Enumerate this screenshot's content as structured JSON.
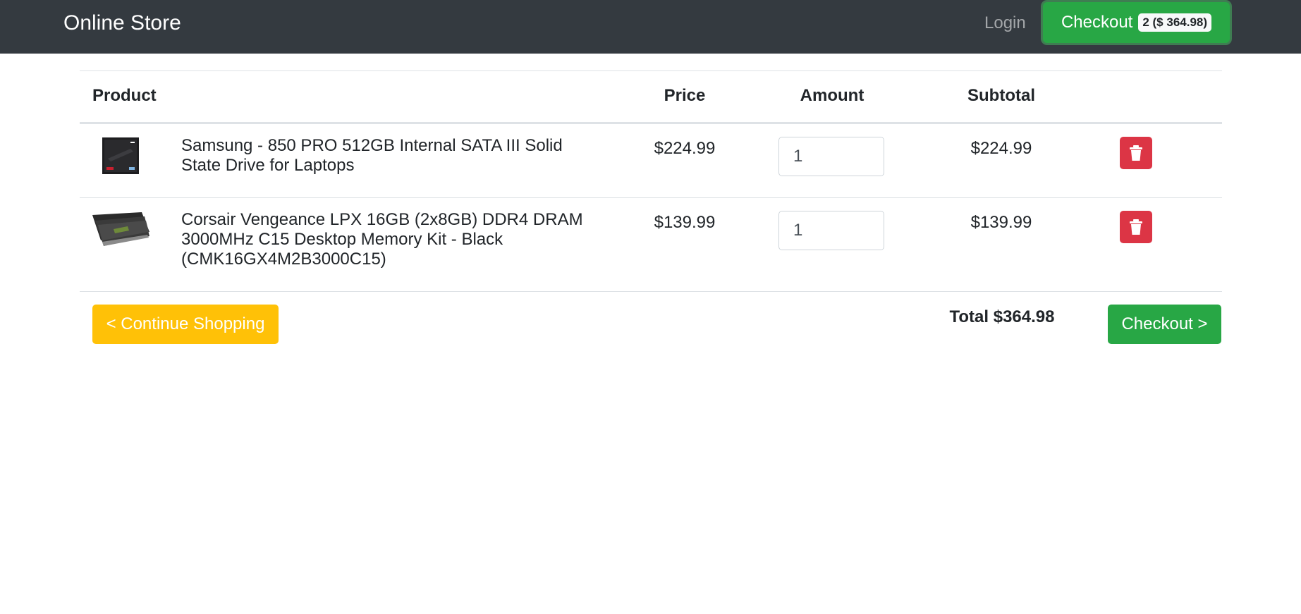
{
  "navbar": {
    "brand": "Online Store",
    "login_label": "Login",
    "checkout_label": "Checkout",
    "cart_badge": "2 ($ 364.98)"
  },
  "table": {
    "headers": {
      "product": "Product",
      "price": "Price",
      "amount": "Amount",
      "subtotal": "Subtotal"
    },
    "rows": [
      {
        "name": "Samsung - 850 PRO 512GB Internal SATA III Solid State Drive for Laptops",
        "price": "$224.99",
        "amount": "1",
        "subtotal": "$224.99",
        "thumbnail": "ssd-box-image",
        "delete_icon": "trash-icon"
      },
      {
        "name": "Corsair Vengeance LPX 16GB (2x8GB) DDR4 DRAM 3000MHz C15 Desktop Memory Kit - Black (CMK16GX4M2B3000C15)",
        "price": "$139.99",
        "amount": "1",
        "subtotal": "$139.99",
        "thumbnail": "ram-kit-image",
        "delete_icon": "trash-icon"
      }
    ]
  },
  "footer": {
    "continue_label": "< Continue Shopping",
    "total_label": "Total $364.98",
    "checkout_label": "Checkout >"
  },
  "colors": {
    "navbar": "#343a40",
    "success": "#28a745",
    "danger": "#dc3545",
    "warning": "#ffc107"
  }
}
